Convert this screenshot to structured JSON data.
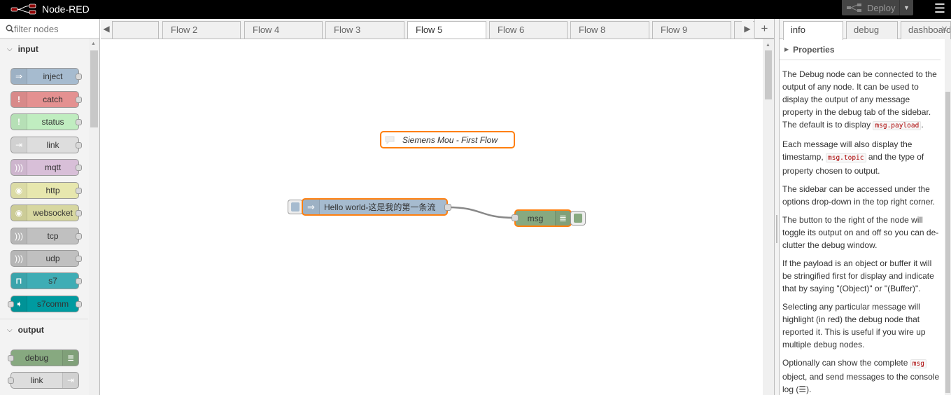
{
  "header": {
    "title": "Node-RED",
    "deploy_label": "Deploy"
  },
  "palette": {
    "search_placeholder": "filter nodes",
    "categories": [
      {
        "label": "input",
        "nodes": [
          {
            "label": "inject",
            "color": "#a6bbcf"
          },
          {
            "label": "catch",
            "color": "#e49191"
          },
          {
            "label": "status",
            "color": "#c0edc0"
          },
          {
            "label": "link",
            "color": "#dddddd"
          },
          {
            "label": "mqtt",
            "color": "#d8bfd8"
          },
          {
            "label": "http",
            "color": "#e7e7ae"
          },
          {
            "label": "websocket",
            "color": "#d7d7a0"
          },
          {
            "label": "tcp",
            "color": "#c0c0c0"
          },
          {
            "label": "udp",
            "color": "#c0c0c0"
          },
          {
            "label": "s7",
            "color": "#3fadb5"
          },
          {
            "label": "s7comm",
            "color": "#009ba0"
          }
        ]
      },
      {
        "label": "output",
        "nodes": [
          {
            "label": "debug",
            "color": "#87a980"
          },
          {
            "label": "link",
            "color": "#dddddd"
          }
        ]
      }
    ]
  },
  "tabs": [
    {
      "label": ""
    },
    {
      "label": "Flow 2"
    },
    {
      "label": "Flow 4"
    },
    {
      "label": "Flow 3"
    },
    {
      "label": "Flow 5",
      "active": true
    },
    {
      "label": "Flow 6"
    },
    {
      "label": "Flow 8"
    },
    {
      "label": "Flow 9"
    },
    {
      "label": ""
    }
  ],
  "workspace": {
    "comment_label": "Siemens Mou - First Flow",
    "inject_label": "Hello world-这是我的第一条流",
    "debug_label": "msg",
    "inject_color": "#a6bbcf",
    "debug_color": "#87a980",
    "selection_color": "#ff7f0e"
  },
  "sidebar": {
    "tabs": [
      "info",
      "debug",
      "dashboard"
    ],
    "properties_label": "Properties",
    "help": {
      "p1_a": "The Debug node can be connected to the output of any node. It can be used to display the output of any message property in the debug tab of the sidebar. The default is to display ",
      "p1_code": "msg.payload",
      "p1_b": ".",
      "p2_a": "Each message will also display the timestamp, ",
      "p2_code": "msg.topic",
      "p2_b": " and the type of property chosen to output.",
      "p3": "The sidebar can be accessed under the options drop-down in the top right corner.",
      "p4": "The button to the right of the node will toggle its output on and off so you can de-clutter the debug window.",
      "p5": "If the payload is an object or buffer it will be stringified first for display and indicate that by saying \"(Object)\" or \"(Buffer)\".",
      "p6": "Selecting any particular message will highlight (in red) the debug node that reported it. This is useful if you wire up multiple debug nodes.",
      "p7_a": "Optionally can show the complete ",
      "p7_code": "msg",
      "p7_b": " object, and send messages to the console log (☰)."
    }
  }
}
